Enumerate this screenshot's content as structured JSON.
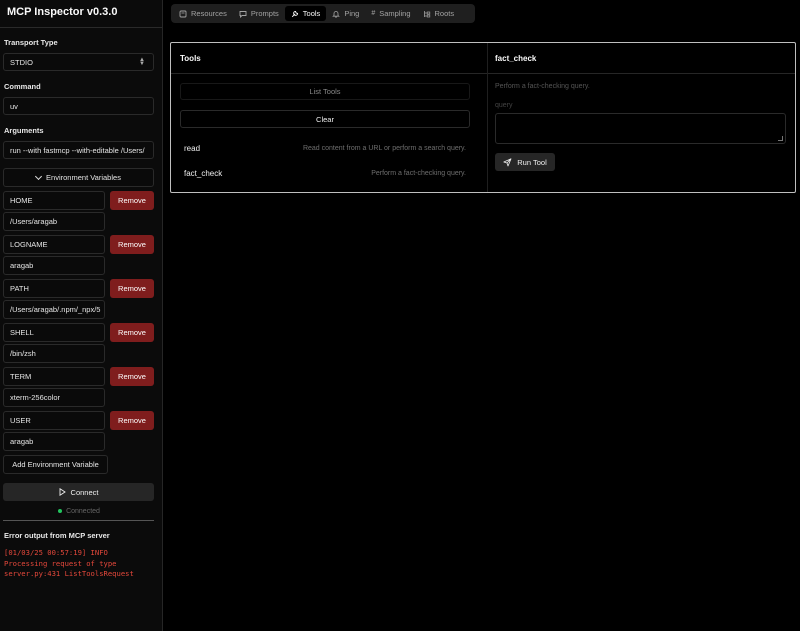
{
  "app": {
    "title": "MCP Inspector v0.3.0"
  },
  "sidebar": {
    "transport_label": "Transport Type",
    "transport_value": "STDIO",
    "command_label": "Command",
    "command_value": "uv",
    "arguments_label": "Arguments",
    "arguments_value": "run --with fastmcp --with-editable /Users/",
    "env_toggle_label": "Environment Variables",
    "env_vars": [
      {
        "key": "HOME",
        "value": "/Users/aragab"
      },
      {
        "key": "LOGNAME",
        "value": "aragab"
      },
      {
        "key": "PATH",
        "value": "/Users/aragab/.npm/_npx/5"
      },
      {
        "key": "SHELL",
        "value": "/bin/zsh"
      },
      {
        "key": "TERM",
        "value": "xterm-256color"
      },
      {
        "key": "USER",
        "value": "aragab"
      }
    ],
    "remove_label": "Remove",
    "add_env_label": "Add Environment Variable",
    "connect_label": "Connect",
    "status_text": "Connected",
    "status_color": "#22c55e",
    "error_title": "Error output from MCP server",
    "error_lines": [
      "[01/03/25 00:57:19] INFO",
      "Processing request of type",
      "server.py:431 ListToolsRequest"
    ]
  },
  "tabs": [
    {
      "label": "Resources",
      "icon": "resources-icon",
      "active": false
    },
    {
      "label": "Prompts",
      "icon": "prompts-icon",
      "active": false
    },
    {
      "label": "Tools",
      "icon": "tools-icon",
      "active": true
    },
    {
      "label": "Ping",
      "icon": "bell-icon",
      "active": false
    },
    {
      "label": "Sampling",
      "icon": "hash-icon",
      "active": false
    },
    {
      "label": "Roots",
      "icon": "roots-icon",
      "active": false
    }
  ],
  "tools_panel": {
    "title": "Tools",
    "list_tools_label": "List Tools",
    "clear_label": "Clear",
    "tools": [
      {
        "name": "read",
        "description": "Read content from a URL or perform a search query."
      },
      {
        "name": "fact_check",
        "description": "Perform a fact-checking query."
      }
    ]
  },
  "detail_panel": {
    "title": "fact_check",
    "description": "Perform a fact-checking query.",
    "query_placeholder": "query",
    "run_label": "Run Tool"
  },
  "colors": {
    "remove_bg": "#7f1d1d",
    "error_text": "#e5483b",
    "panel_border": "#bfbfbf"
  }
}
